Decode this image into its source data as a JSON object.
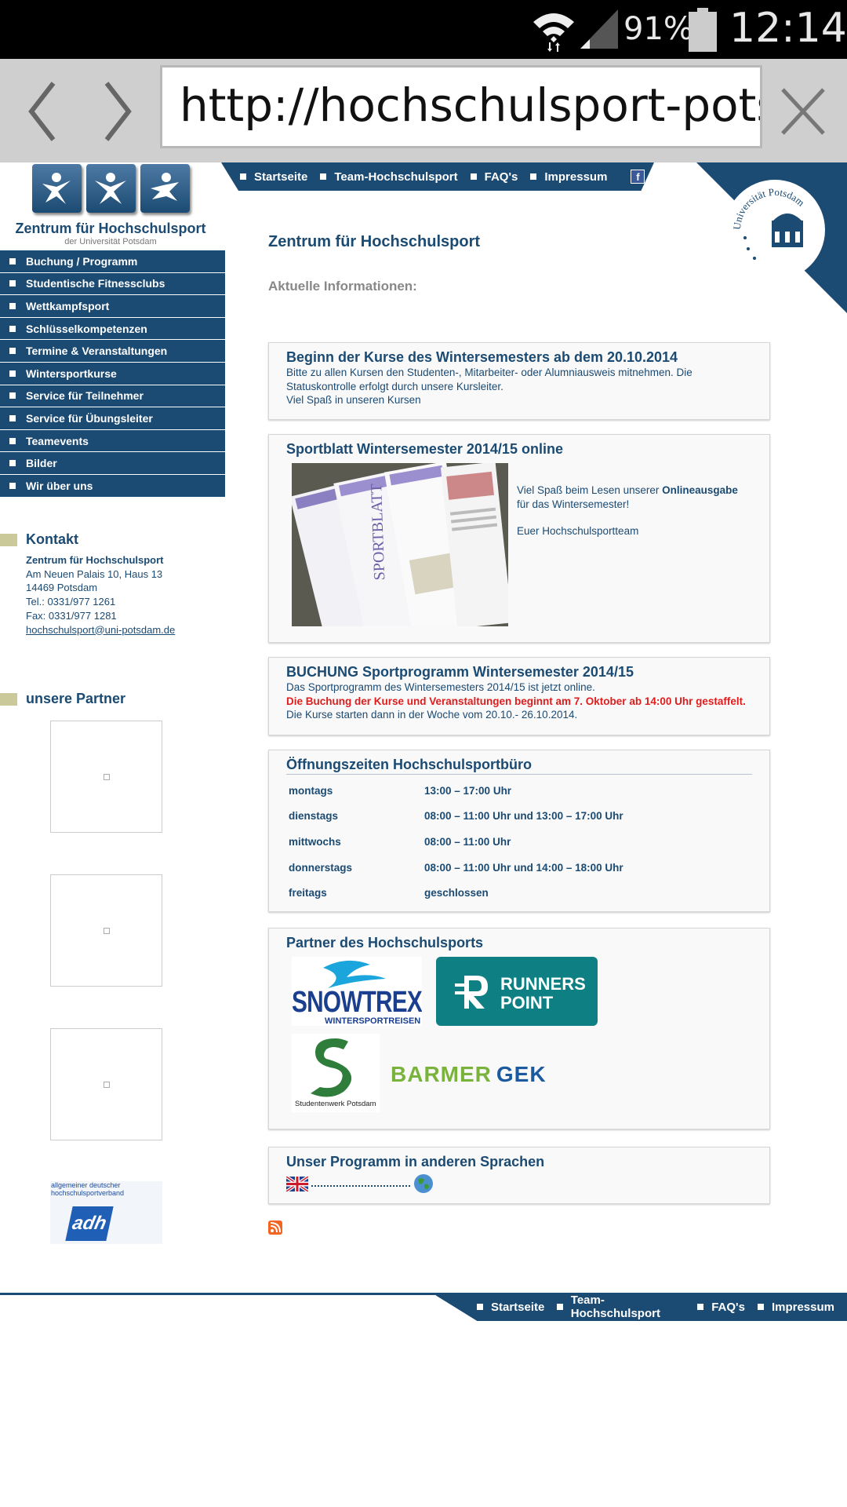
{
  "status_bar": {
    "battery_pct": "91%",
    "clock": "12:14",
    "icons": [
      "wifi-icon",
      "signal-icon",
      "battery-icon"
    ]
  },
  "browser": {
    "url": "http://hochschulsport-potsda"
  },
  "logo": {
    "title": "Zentrum für Hochschulsport",
    "subtitle": "der Universität Potsdam"
  },
  "top_nav": [
    "Startseite",
    "Team-Hochschulsport",
    "FAQ's",
    "Impressum"
  ],
  "side_nav": [
    "Buchung / Programm",
    "Studentische Fitnessclubs",
    "Wettkampfsport",
    "Schlüsselkompetenzen",
    "Termine & Veranstaltungen",
    "Wintersportkurse",
    "Service für Teilnehmer",
    "Service für Übungsleiter",
    "Teamevents",
    "Bilder",
    "Wir über uns"
  ],
  "contact": {
    "heading": "Kontakt",
    "name": "Zentrum für Hochschulsport",
    "street": "Am Neuen Palais 10, Haus 13",
    "city": "14469 Potsdam",
    "tel": "Tel.: 0331/977 1261",
    "fax": "Fax: 0331/977 1281",
    "email": "hochschulsport@uni-potsdam.de"
  },
  "partners_side": {
    "heading": "unsere Partner",
    "adh_text": "allgemeiner deutscher hochschulsportverband",
    "adh_mark": "adh"
  },
  "seal": {
    "text": "Universität Potsdam"
  },
  "main": {
    "title": "Zentrum für Hochschulsport",
    "subtitle": "Aktuelle Informationen:",
    "news1": {
      "title": "Beginn der Kurse des Wintersemesters ab dem 20.10.2014",
      "line1": "Bitte zu allen Kursen den Studenten-, Mitarbeiter- oder Alumniausweis mitnehmen. Die Statuskontrolle erfolgt durch unsere Kursleiter.",
      "line2": "Viel Spaß in unseren Kursen"
    },
    "news2": {
      "title": "Sportblatt Wintersemester 2014/15 online",
      "text_pre": "Viel Spaß beim Lesen unserer ",
      "text_link": "Onlineausgabe",
      "text_post": "für das Wintersemester!",
      "sign": "Euer Hochschulsportteam",
      "image_label": "SPORTBLATT"
    },
    "news3": {
      "title": "BUCHUNG Sportprogramm Wintersemester 2014/15",
      "line1": "Das Sportprogramm des Wintersemesters 2014/15 ist jetzt online.",
      "line_red": "Die Buchung der Kurse und Veranstaltungen beginnt am 7. Oktober ab 14:00 Uhr gestaffelt.",
      "line3": "Die Kurse starten dann in der Woche vom 20.10.- 26.10.2014."
    },
    "hours": {
      "title": "Öffnungszeiten Hochschulsportbüro",
      "rows": [
        {
          "day": "montags",
          "time": "13:00 – 17:00 Uhr"
        },
        {
          "day": "dienstags",
          "time": "08:00 – 11:00 Uhr und 13:00 – 17:00 Uhr"
        },
        {
          "day": "mittwochs",
          "time": "08:00 – 11:00 Uhr"
        },
        {
          "day": "donnerstags",
          "time": "08:00 – 11:00 Uhr und 14:00 – 18:00 Uhr"
        },
        {
          "day": "freitags",
          "time": "geschlossen"
        }
      ]
    },
    "partners": {
      "title": "Partner des Hochschulsports",
      "snowtrex": "SNOWTREX",
      "snowtrex_sub": "WINTERSPORTREISEN",
      "runners1": "RUNNERS",
      "runners2": "POINT",
      "stw": "Studentenwerk Potsdam",
      "barmer1": "BARMER",
      "barmer2": "GEK"
    },
    "languages": {
      "title": "Unser Programm in anderen Sprachen"
    }
  },
  "footer_nav": [
    "Startseite",
    "Team-Hochschulsport",
    "FAQ's",
    "Impressum"
  ],
  "colors": {
    "brand": "#1b4a72",
    "alert": "#e01c1c",
    "box_bg": "#f9f9f9"
  }
}
